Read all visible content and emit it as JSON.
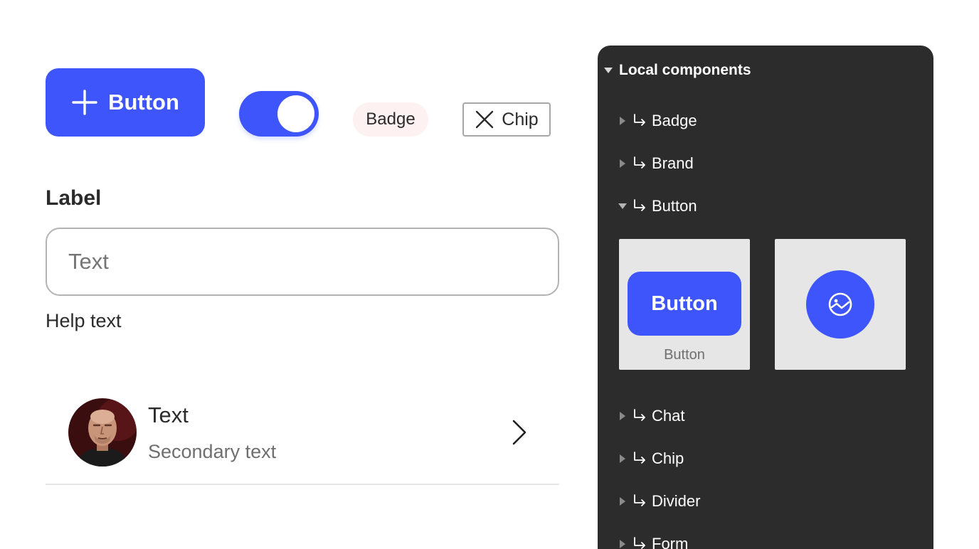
{
  "showcase": {
    "button": {
      "label": "Button",
      "icon": "plus-icon"
    },
    "toggle": {
      "state": "on"
    },
    "badge": {
      "label": "Badge"
    },
    "chip": {
      "label": "Chip",
      "icon": "close-icon"
    },
    "form": {
      "label": "Label",
      "placeholder": "Text",
      "value": "",
      "help_text": "Help text"
    },
    "list_item": {
      "primary": "Text",
      "secondary": "Secondary text",
      "avatar": "avatar-photo",
      "trailing_icon": "chevron-right-icon"
    }
  },
  "panel": {
    "title": "Local components",
    "items": [
      {
        "label": "Badge",
        "expanded": false
      },
      {
        "label": "Brand",
        "expanded": false
      },
      {
        "label": "Button",
        "expanded": true
      },
      {
        "label": "Chat",
        "expanded": false
      },
      {
        "label": "Chip",
        "expanded": false
      },
      {
        "label": "Divider",
        "expanded": false
      },
      {
        "label": "Form",
        "expanded": false
      }
    ],
    "button_variants": [
      {
        "preview_label": "Button",
        "caption": "Button"
      },
      {
        "icon": "image-icon",
        "caption": ""
      }
    ]
  },
  "colors": {
    "accent": "#3d55fb",
    "panel_bg": "#2c2c2c",
    "badge_bg": "#fdf1f1",
    "thumb_bg": "#e6e6e6"
  }
}
